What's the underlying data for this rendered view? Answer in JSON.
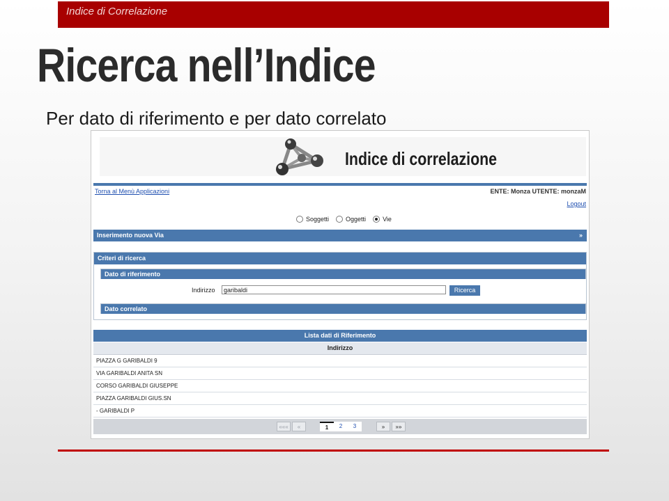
{
  "slide": {
    "header_label": "Indice di Correlazione",
    "title": "Ricerca nell’Indice",
    "subtitle": "Per dato di riferimento e per dato correlato"
  },
  "app": {
    "banner_title": "Indice di correlazione",
    "back_link": "Torna al Menù Applicazioni",
    "user_info": "ENTE: Monza  UTENTE: monzaM",
    "logout": "Logout",
    "radio_options": [
      {
        "label": "Soggetti",
        "selected": false
      },
      {
        "label": "Oggetti",
        "selected": false
      },
      {
        "label": "Vie",
        "selected": true
      }
    ],
    "insert_bar": {
      "label": "Inserimento nuova Via",
      "arrow": "»"
    },
    "criteria": {
      "title": "Criteri di ricerca",
      "reference_title": "Dato di riferimento",
      "field_label": "Indirizzo",
      "field_value": "garibaldi",
      "search_button": "Ricerca",
      "correlated_title": "Dato correlato"
    },
    "list": {
      "title": "Lista dati di Riferimento",
      "column": "Indirizzo",
      "rows": [
        "PIAZZA G GARIBALDI 9",
        "VIA GARIBALDI ANITA SN",
        "CORSO GARIBALDI GIUSEPPE",
        "PIAZZA GARIBALDI GIUS.SN",
        "- GARIBALDI P"
      ]
    },
    "pager": {
      "first": "«««",
      "prev": "«",
      "pages": [
        "1",
        "2",
        "3"
      ],
      "current": "1",
      "next": "»",
      "last": "»»"
    }
  },
  "colors": {
    "header_red": "#a80000",
    "app_blue": "#4a78ad"
  }
}
